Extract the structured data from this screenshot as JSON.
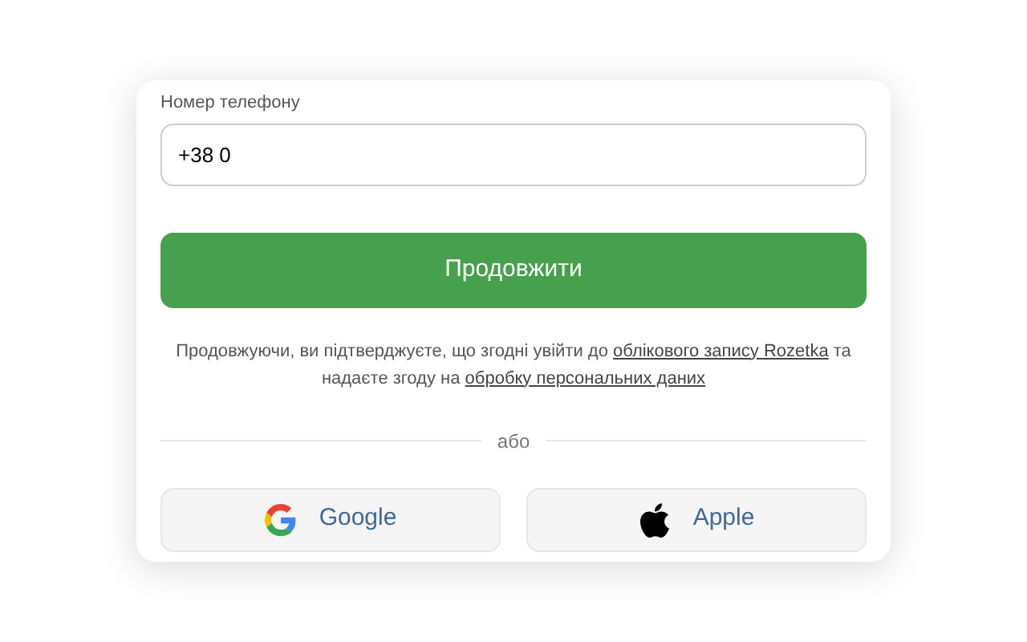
{
  "phone_field": {
    "label": "Номер телефону",
    "value": "+38 0"
  },
  "continue_button": {
    "label": "Продовжити"
  },
  "consent": {
    "text_before": "Продовжуючи, ви підтверджуєте, що згодні увійти до",
    "account_link": "облікового запису Rozetka",
    "text_middle": "та надаєте згоду на",
    "data_link": "обробку персональних даних"
  },
  "divider_label": "або",
  "social_buttons": [
    {
      "kind": "google",
      "label": "Google"
    },
    {
      "kind": "apple",
      "label": "Apple"
    }
  ]
}
